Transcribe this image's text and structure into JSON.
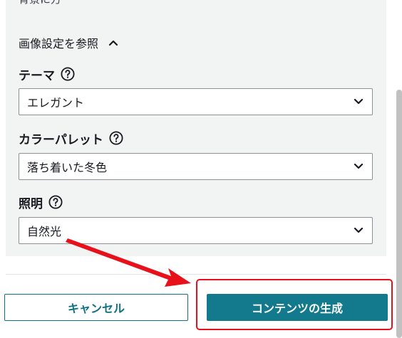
{
  "clipped_text": "背景に方",
  "section": {
    "title": "画像設定を参照",
    "icon": "chevron-up-icon"
  },
  "fields": [
    {
      "label": "テーマ",
      "value": "エレガント",
      "help_icon": "help-circle-icon"
    },
    {
      "label": "カラーパレット",
      "value": "落ち着いた冬色",
      "help_icon": "help-circle-icon"
    },
    {
      "label": "照明",
      "value": "自然光",
      "help_icon": "help-circle-icon"
    }
  ],
  "footer": {
    "cancel_label": "キャンセル",
    "generate_label": "コンテンツの生成"
  },
  "colors": {
    "primary": "#127a8c",
    "panel_background": "#f2f3f3",
    "annotation_red": "#e8101a"
  }
}
